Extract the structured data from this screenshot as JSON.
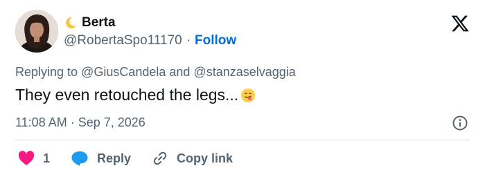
{
  "author": {
    "display_name": "Berta",
    "name_emoji_icon": "crescent-moon-icon",
    "handle": "@RobertaSpo11170",
    "separator": "·",
    "follow_label": "Follow"
  },
  "platform_icon": "x-logo-icon",
  "reply_context": "Replying to @GiusCandela and @stanzaselvaggia",
  "tweet": {
    "text": "They even retouched the legs...",
    "emoji_icon": "face-with-tongue-icon"
  },
  "timestamp": "11:08 AM · Sep 7, 2026",
  "info_icon": "info-circle-icon",
  "actions": {
    "like_icon": "heart-icon",
    "like_count": "1",
    "reply_icon": "speech-bubble-icon",
    "reply_label": "Reply",
    "copy_icon": "link-icon",
    "copy_label": "Copy link"
  },
  "colors": {
    "link_blue": "#006fd6",
    "heart_red": "#f91880",
    "reply_blue": "#1d9bf0",
    "muted_text": "#536471",
    "divider": "#cfd9de"
  }
}
